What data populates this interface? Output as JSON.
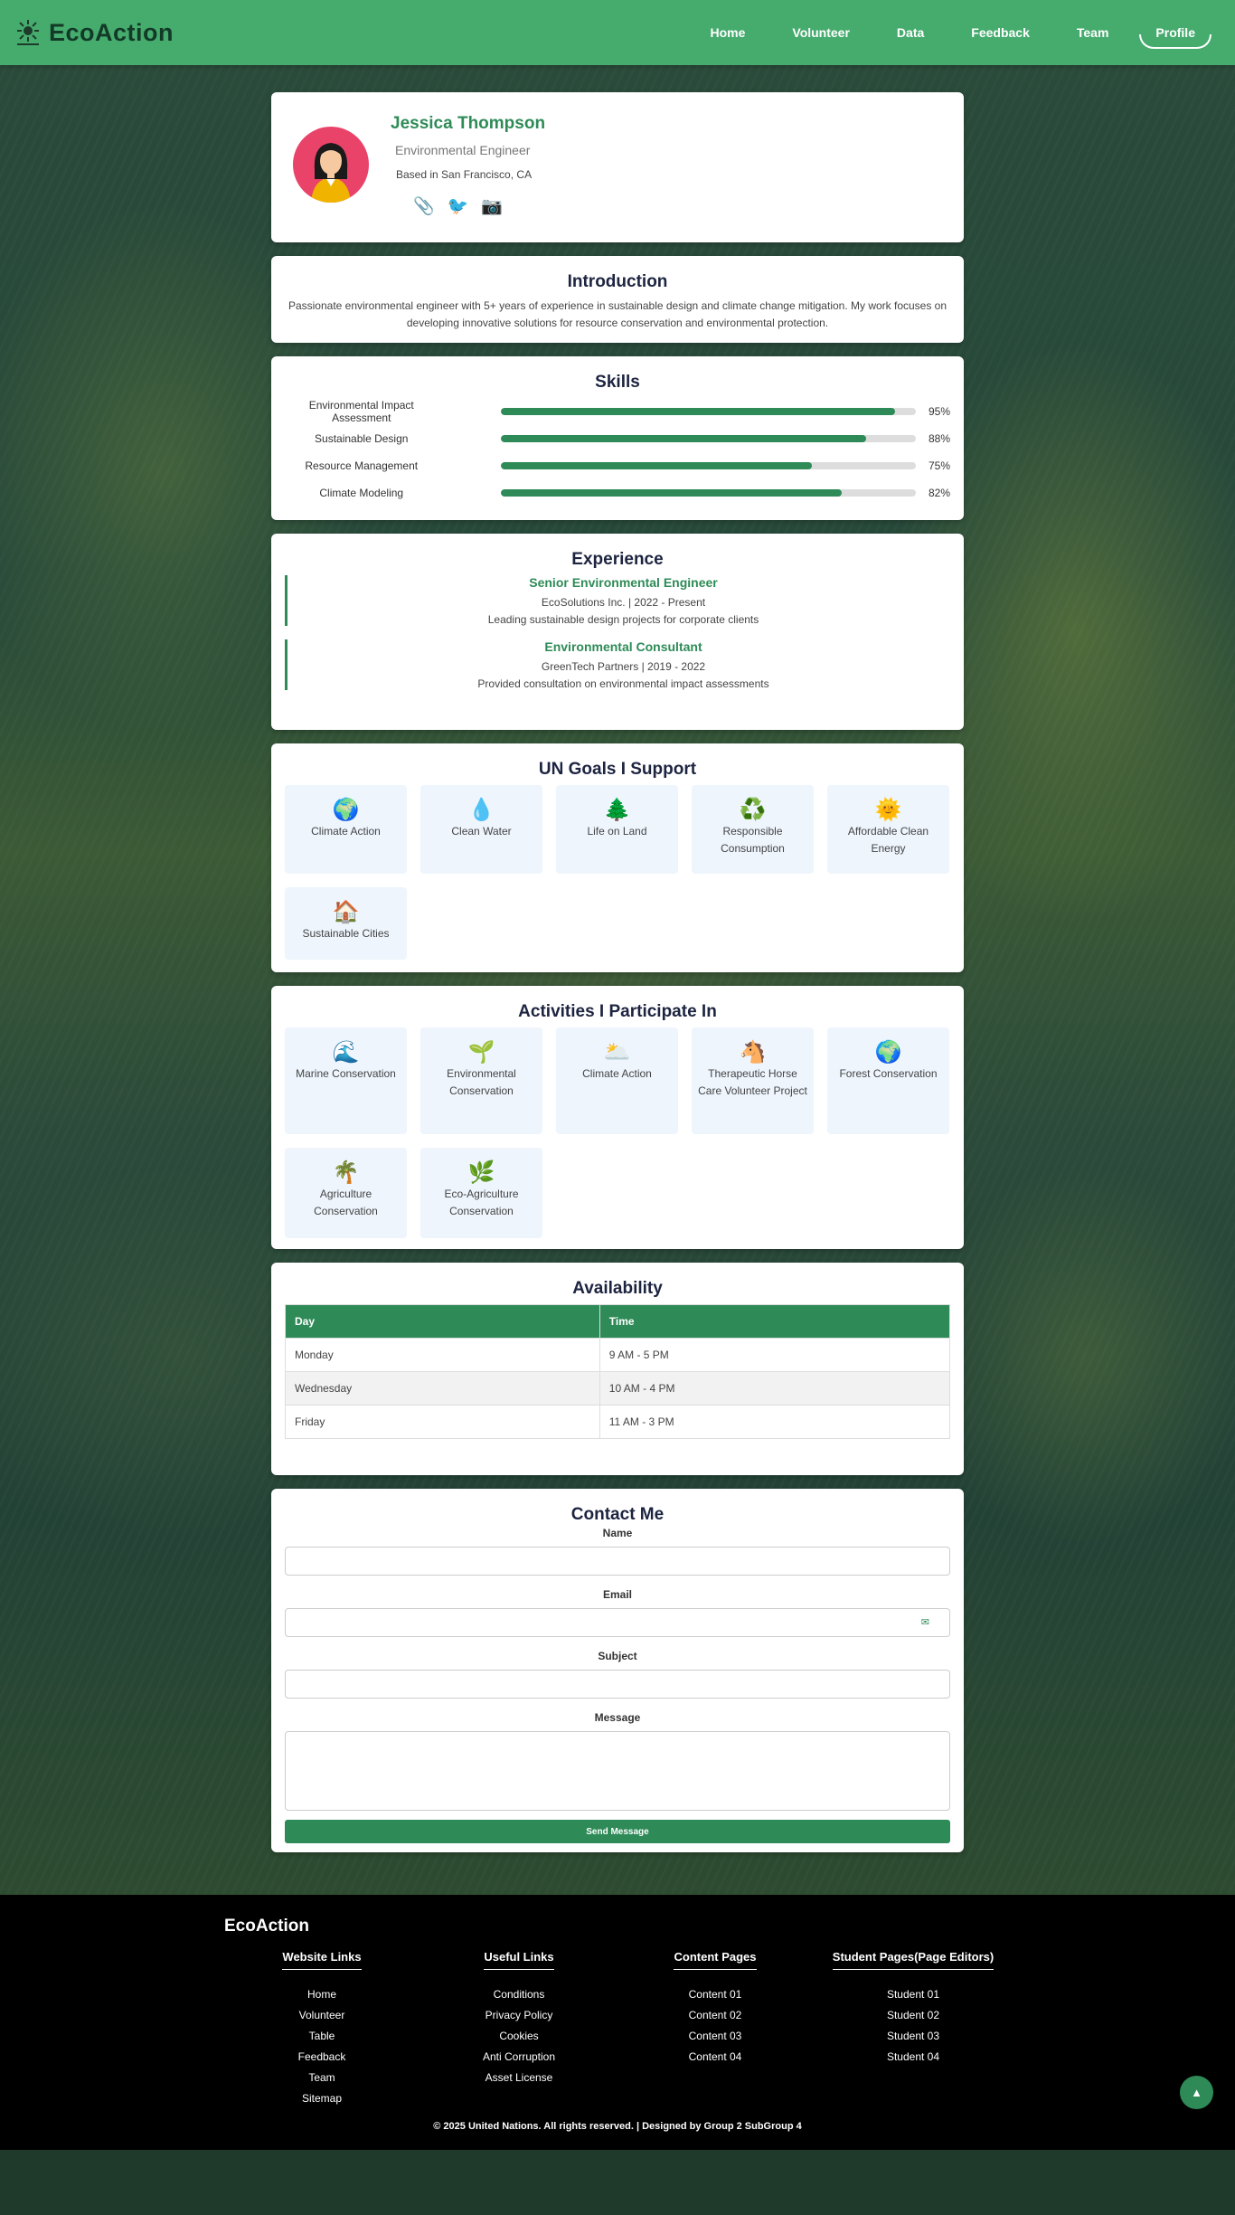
{
  "header": {
    "brand": "EcoAction",
    "nav": [
      "Home",
      "Volunteer",
      "Data",
      "Feedback",
      "Team",
      "Profile"
    ],
    "active_nav": "Profile"
  },
  "profile": {
    "name": "Jessica Thompson",
    "role": "Environmental Engineer",
    "location": "Based in San Francisco, CA",
    "social_icons": [
      "📎",
      "🐦",
      "📷"
    ]
  },
  "intro": {
    "title": "Introduction",
    "text": "Passionate environmental engineer with 5+ years of experience in sustainable design and climate change mitigation. My work focuses on developing innovative solutions for resource conservation and environmental protection."
  },
  "skills": {
    "title": "Skills",
    "items": [
      {
        "name": "Environmental Impact Assessment",
        "pct": 95,
        "label": "95%"
      },
      {
        "name": "Sustainable Design",
        "pct": 88,
        "label": "88%"
      },
      {
        "name": "Resource Management",
        "pct": 75,
        "label": "75%"
      },
      {
        "name": "Climate Modeling",
        "pct": 82,
        "label": "82%"
      }
    ]
  },
  "experience": {
    "title": "Experience",
    "items": [
      {
        "title": "Senior Environmental Engineer",
        "sub": "EcoSolutions Inc. | 2022 - Present",
        "desc": "Leading sustainable design projects for corporate clients"
      },
      {
        "title": "Environmental Consultant",
        "sub": "GreenTech Partners | 2019 - 2022",
        "desc": "Provided consultation on environmental impact assessments"
      }
    ]
  },
  "goals": {
    "title": "UN Goals I Support",
    "items": [
      {
        "icon": "🌍",
        "label": "Climate Action"
      },
      {
        "icon": "💧",
        "label": "Clean Water"
      },
      {
        "icon": "🌲",
        "label": "Life on Land"
      },
      {
        "icon": "♻️",
        "label": "Responsible Consumption"
      },
      {
        "icon": "🌞",
        "label": "Affordable Clean Energy"
      },
      {
        "icon": "🏠",
        "label": "Sustainable Cities"
      }
    ]
  },
  "activities": {
    "title": "Activities I Participate In",
    "items": [
      {
        "icon": "🌊",
        "label": "Marine Conservation"
      },
      {
        "icon": "🌱",
        "label": "Environmental Conservation"
      },
      {
        "icon": "🌥️",
        "label": "Climate Action"
      },
      {
        "icon": "🐴",
        "label": "Therapeutic Horse Care Volunteer Project"
      },
      {
        "icon": "🌍",
        "label": "Forest Conservation"
      },
      {
        "icon": "🌴",
        "label": "Agriculture Conservation"
      },
      {
        "icon": "🌿",
        "label": "Eco-Agriculture Conservation"
      }
    ]
  },
  "availability": {
    "title": "Availability",
    "headers": [
      "Day",
      "Time"
    ],
    "rows": [
      [
        "Monday",
        "9 AM - 5 PM"
      ],
      [
        "Wednesday",
        "10 AM - 4 PM"
      ],
      [
        "Friday",
        "11 AM - 3 PM"
      ]
    ]
  },
  "contact": {
    "title": "Contact Me",
    "name_label": "Name",
    "email_label": "Email",
    "subject_label": "Subject",
    "message_label": "Message",
    "send_label": "Send Message"
  },
  "footer": {
    "brand": "EcoAction",
    "columns": [
      {
        "title": "Website Links",
        "links": [
          "Home",
          "Volunteer",
          "Table",
          "Feedback",
          "Team",
          "Sitemap"
        ]
      },
      {
        "title": "Useful Links",
        "links": [
          "Conditions",
          "Privacy Policy",
          "Cookies",
          "Anti Corruption",
          "Asset License"
        ]
      },
      {
        "title": "Content Pages",
        "links": [
          "Content 01",
          "Content 02",
          "Content 03",
          "Content 04"
        ]
      },
      {
        "title": "Student Pages(Page Editors)",
        "links": [
          "Student 01",
          "Student 02",
          "Student 03",
          "Student 04"
        ]
      }
    ],
    "copyright": "© 2025 United Nations. All rights reserved. | Designed by Group 2 SubGroup 4",
    "to_top_icon": "▲"
  },
  "colors": {
    "header_bg": "#46ac6e",
    "accent": "#2e8b57",
    "footer_bg": "#000000"
  }
}
